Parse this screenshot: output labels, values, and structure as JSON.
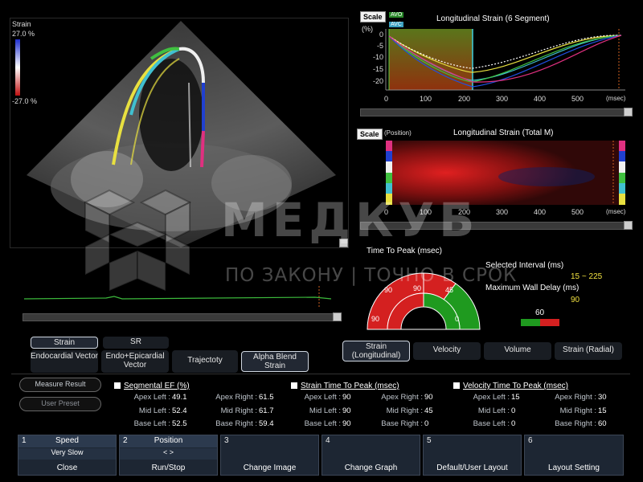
{
  "viewport": {
    "strain_label": "Strain",
    "scale_max": "27.0 %",
    "scale_min": "-27.0 %"
  },
  "graph1": {
    "scale_label": "Scale",
    "title": "Longitudinal Strain (6 Segment)",
    "unit_y": "(%)",
    "unit_x": "(msec)",
    "avo_label": "AVO",
    "avc_label": "AVC",
    "y_ticks": [
      "0",
      "-5",
      "-10",
      "-15",
      "-20"
    ],
    "x_ticks": [
      "0",
      "100",
      "200",
      "300",
      "400",
      "500"
    ]
  },
  "graph2": {
    "scale_label": "Scale",
    "position_label": "(Position)",
    "title": "Longitudinal Strain (Total M)",
    "unit_x": "(msec)",
    "x_ticks": [
      "0",
      "100",
      "200",
      "300",
      "400",
      "500"
    ]
  },
  "ttp": {
    "title": "Time To Peak (msec)",
    "segments": [
      "90",
      "90",
      "90",
      "45",
      "0"
    ],
    "selected_interval_label": "Selected Interval (ms)",
    "selected_interval_value": "15 ~ 225",
    "max_wall_delay_label": "Maximum Wall Delay (ms)",
    "max_wall_delay_value": "90",
    "bar_value": "60",
    "colors": {
      "red": "#d42020",
      "green": "#1f9a1f"
    }
  },
  "mode_buttons": {
    "strain": "Strain",
    "sr": "SR",
    "endocardial_vector": "Endocardial Vector",
    "endo_epicardial_vector": "Endo+Epicardial Vector",
    "trajectory": "Trajectoty",
    "alpha_blend": "Alpha Blend Strain"
  },
  "view_tabs": {
    "strain_longitudinal": "Strain (Longitudinal)",
    "velocity": "Velocity",
    "volume": "Volume",
    "strain_radial": "Strain (Radial)"
  },
  "results": {
    "measure_result": "Measure Result",
    "user_preset": "User Preset",
    "segmental_ef": {
      "title": "Segmental EF (%)",
      "apex_left_l": "Apex Left :",
      "apex_left_v": "49.1",
      "mid_left_l": "Mid Left :",
      "mid_left_v": "52.4",
      "base_left_l": "Base Left :",
      "base_left_v": "52.5",
      "apex_right_l": "Apex Right :",
      "apex_right_v": "61.5",
      "mid_right_l": "Mid Right :",
      "mid_right_v": "61.7",
      "base_right_l": "Base Right :",
      "base_right_v": "59.4"
    },
    "strain_ttp": {
      "title": "Strain Time To Peak (msec)",
      "apex_left_l": "Apex Left :",
      "apex_left_v": "90",
      "mid_left_l": "Mid Left :",
      "mid_left_v": "90",
      "base_left_l": "Base Left :",
      "base_left_v": "90",
      "apex_right_l": "Apex Right :",
      "apex_right_v": "90",
      "mid_right_l": "Mid Right :",
      "mid_right_v": "45",
      "base_right_l": "Base Right :",
      "base_right_v": "0"
    },
    "velocity_ttp": {
      "title": "Velocity Time To Peak (msec)",
      "apex_left_l": "Apex Left :",
      "apex_left_v": "15",
      "mid_left_l": "Mid Left :",
      "mid_left_v": "0",
      "base_left_l": "Base Left :",
      "base_left_v": "0",
      "apex_right_l": "Apex Right :",
      "apex_right_v": "30",
      "mid_right_l": "Mid Right :",
      "mid_right_v": "15",
      "base_right_l": "Base Right :",
      "base_right_v": "60"
    }
  },
  "function_bar": {
    "cells": [
      {
        "num": "1",
        "top": "Speed",
        "mid": "Very Slow",
        "bottom": "Close"
      },
      {
        "num": "2",
        "top": "Position",
        "mid": "< >",
        "bottom": "Run/Stop"
      },
      {
        "num": "3",
        "top": "",
        "mid": "",
        "bottom": "Change Image"
      },
      {
        "num": "4",
        "top": "",
        "mid": "",
        "bottom": "Change Graph"
      },
      {
        "num": "5",
        "top": "",
        "mid": "",
        "bottom": "Default/User Layout"
      },
      {
        "num": "6",
        "top": "",
        "mid": "",
        "bottom": "Layout Setting"
      }
    ]
  },
  "watermark": {
    "brand": "МЕДКУБ",
    "slogan": "ПО ЗАКОНУ | ТОЧНО В СРОК"
  }
}
